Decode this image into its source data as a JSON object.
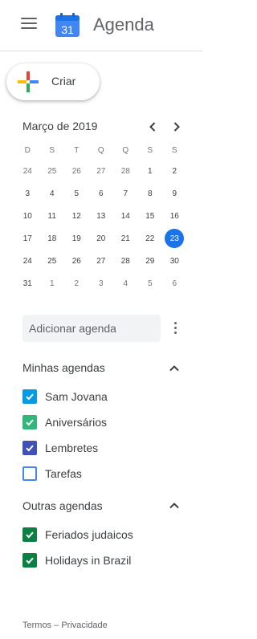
{
  "header": {
    "title": "Agenda",
    "logo_day": "31"
  },
  "create": {
    "label": "Criar"
  },
  "mini_calendar": {
    "month_label": "Março de 2019",
    "weekdays": [
      "D",
      "S",
      "T",
      "Q",
      "Q",
      "S",
      "S"
    ],
    "weeks": [
      [
        {
          "d": "24",
          "other": true
        },
        {
          "d": "25",
          "other": true
        },
        {
          "d": "26",
          "other": true
        },
        {
          "d": "27",
          "other": true
        },
        {
          "d": "28",
          "other": true
        },
        {
          "d": "1"
        },
        {
          "d": "2"
        }
      ],
      [
        {
          "d": "3"
        },
        {
          "d": "4"
        },
        {
          "d": "5"
        },
        {
          "d": "6"
        },
        {
          "d": "7"
        },
        {
          "d": "8"
        },
        {
          "d": "9"
        }
      ],
      [
        {
          "d": "10"
        },
        {
          "d": "11"
        },
        {
          "d": "12"
        },
        {
          "d": "13"
        },
        {
          "d": "14"
        },
        {
          "d": "15"
        },
        {
          "d": "16"
        }
      ],
      [
        {
          "d": "17"
        },
        {
          "d": "18"
        },
        {
          "d": "19"
        },
        {
          "d": "20"
        },
        {
          "d": "21"
        },
        {
          "d": "22"
        },
        {
          "d": "23",
          "today": true
        }
      ],
      [
        {
          "d": "24"
        },
        {
          "d": "25"
        },
        {
          "d": "26"
        },
        {
          "d": "27"
        },
        {
          "d": "28"
        },
        {
          "d": "29"
        },
        {
          "d": "30"
        }
      ],
      [
        {
          "d": "31"
        },
        {
          "d": "1",
          "other": true
        },
        {
          "d": "2",
          "other": true
        },
        {
          "d": "3",
          "other": true
        },
        {
          "d": "4",
          "other": true
        },
        {
          "d": "5",
          "other": true
        },
        {
          "d": "6",
          "other": true
        }
      ]
    ]
  },
  "add_calendar": {
    "placeholder": "Adicionar agenda"
  },
  "my_calendars": {
    "title": "Minhas agendas",
    "items": [
      {
        "name": "Sam Jovana",
        "color": "#039be5",
        "checked": true
      },
      {
        "name": "Aniversários",
        "color": "#33b679",
        "checked": true
      },
      {
        "name": "Lembretes",
        "color": "#3f51b5",
        "checked": true
      },
      {
        "name": "Tarefas",
        "color": "#4285f4",
        "checked": false
      }
    ]
  },
  "other_calendars": {
    "title": "Outras agendas",
    "items": [
      {
        "name": "Feriados judaicos",
        "color": "#0b8043",
        "checked": true
      },
      {
        "name": "Holidays in Brazil",
        "color": "#0b8043",
        "checked": true
      }
    ]
  },
  "footer": {
    "terms": "Termos",
    "separator": "–",
    "privacy": "Privacidade"
  },
  "colors": {
    "accent": "#1a73e8"
  }
}
